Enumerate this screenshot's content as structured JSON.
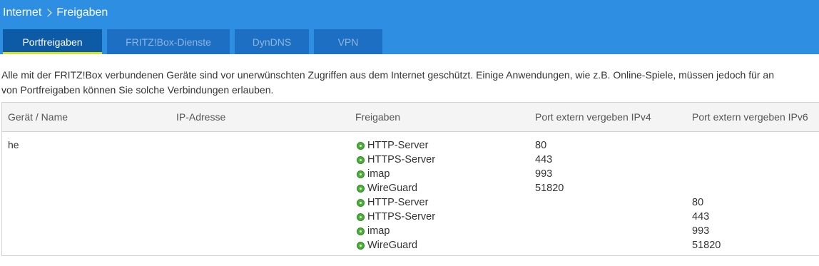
{
  "breadcrumb": {
    "parent": "Internet",
    "current": "Freigaben"
  },
  "tabs": [
    {
      "label": "Portfreigaben"
    },
    {
      "label": "FRITZ!Box-Dienste"
    },
    {
      "label": "DynDNS"
    },
    {
      "label": "VPN"
    }
  ],
  "active_tab": "Portfreigaben",
  "intro": {
    "line1": "Alle mit der FRITZ!Box verbundenen Geräte sind vor unerwünschten Zugriffen aus dem Internet geschützt. Einige Anwendungen, wie z.B. Online-Spiele, müssen jedoch für an",
    "line2": "von Portfreigaben können Sie solche Verbindungen erlauben."
  },
  "table": {
    "headers": {
      "device": "Gerät / Name",
      "ip": "IP-Adresse",
      "shares": "Freigaben",
      "ipv4": "Port extern vergeben IPv4",
      "ipv6": "Port extern vergeben IPv6"
    },
    "device": {
      "name": "he",
      "ip": ""
    },
    "rows": [
      {
        "share": "HTTP-Server",
        "ipv4": "80",
        "ipv6": ""
      },
      {
        "share": "HTTPS-Server",
        "ipv4": "443",
        "ipv6": ""
      },
      {
        "share": "imap",
        "ipv4": "993",
        "ipv6": ""
      },
      {
        "share": "WireGuard",
        "ipv4": "51820",
        "ipv6": ""
      },
      {
        "share": "HTTP-Server",
        "ipv4": "",
        "ipv6": "80"
      },
      {
        "share": "HTTPS-Server",
        "ipv4": "",
        "ipv6": "443"
      },
      {
        "share": "imap",
        "ipv4": "",
        "ipv6": "993"
      },
      {
        "share": "WireGuard",
        "ipv4": "",
        "ipv6": "51820"
      }
    ]
  },
  "colors": {
    "header": "#2d8ee2",
    "tab": "#1c6fc2",
    "tab_active": "#0d5aa6",
    "tab_active_underline": "#d6e41f",
    "status_active": "#4dae3b"
  },
  "icons": {
    "status": "status-active-icon",
    "breadcrumb_separator": "chevron-right-icon"
  }
}
